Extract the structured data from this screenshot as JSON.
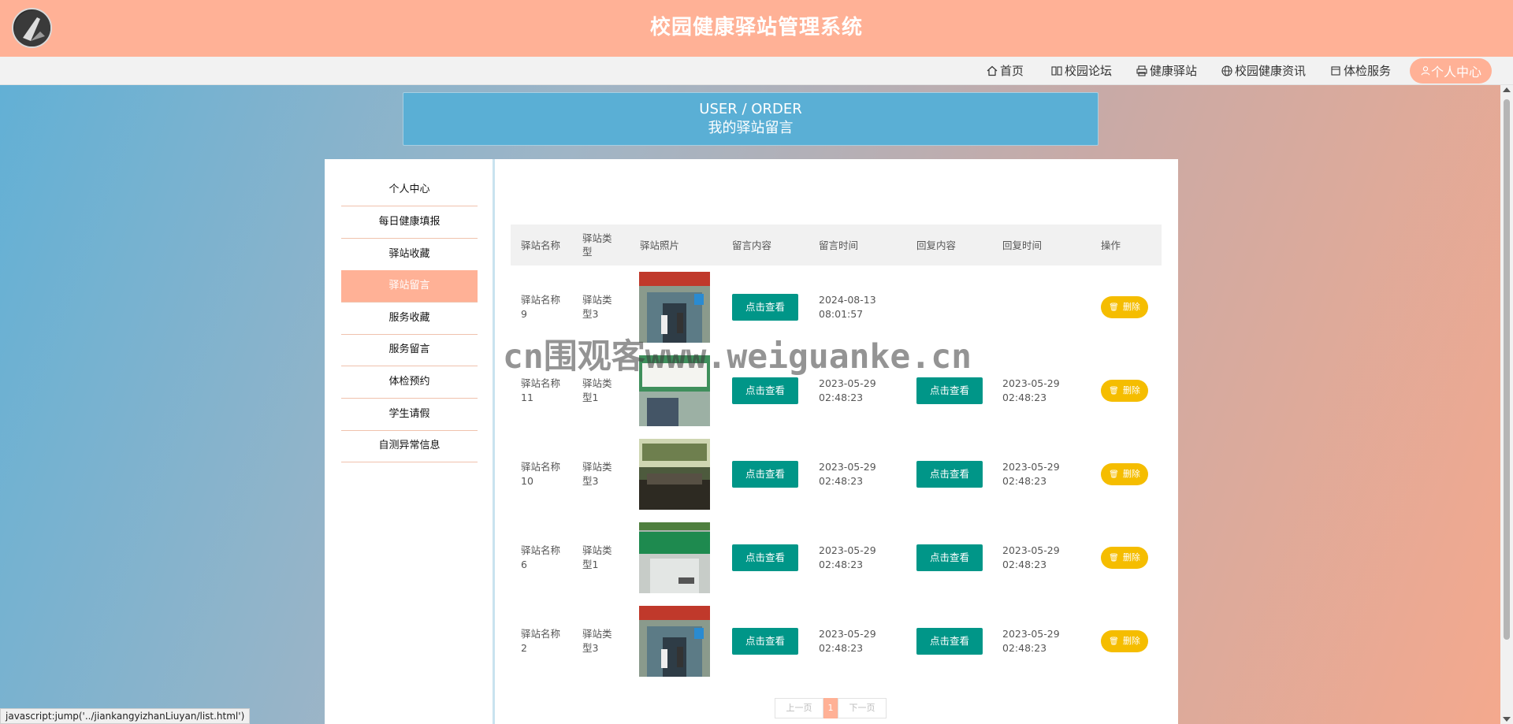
{
  "site": {
    "title": "校园健康驿站管理系统"
  },
  "nav": {
    "items": [
      {
        "label": "首页",
        "icon": "home-icon"
      },
      {
        "label": "校园论坛",
        "icon": "book-icon"
      },
      {
        "label": "健康驿站",
        "icon": "printer-icon"
      },
      {
        "label": "校园健康资讯",
        "icon": "globe-icon"
      },
      {
        "label": "体检服务",
        "icon": "calendar-icon"
      }
    ],
    "active": {
      "label": "个人中心",
      "icon": "user-icon"
    }
  },
  "header": {
    "en": "USER / ORDER",
    "cn": "我的驿站留言"
  },
  "sidebar": {
    "items": [
      {
        "label": "个人中心"
      },
      {
        "label": "每日健康填报"
      },
      {
        "label": "驿站收藏"
      },
      {
        "label": "驿站留言",
        "active": true
      },
      {
        "label": "服务收藏"
      },
      {
        "label": "服务留言"
      },
      {
        "label": "体检预约"
      },
      {
        "label": "学生请假"
      },
      {
        "label": "自测异常信息"
      }
    ]
  },
  "table": {
    "columns": [
      "驿站名称",
      "驿站类型",
      "驿站照片",
      "留言内容",
      "留言时间",
      "回复内容",
      "回复时间",
      "操作"
    ],
    "view_label": "点击查看",
    "delete_label": "删除",
    "rows": [
      {
        "name": "驿站名称9",
        "type": "驿站类型3",
        "photo": "station-photo-a",
        "msg_time": "2024-08-13 08:01:57",
        "reply_time": "",
        "has_reply": false
      },
      {
        "name": "驿站名称11",
        "type": "驿站类型1",
        "photo": "station-photo-b",
        "msg_time": "2023-05-29 02:48:23",
        "reply_time": "2023-05-29 02:48:23",
        "has_reply": true
      },
      {
        "name": "驿站名称10",
        "type": "驿站类型3",
        "photo": "station-photo-c",
        "msg_time": "2023-05-29 02:48:23",
        "reply_time": "2023-05-29 02:48:23",
        "has_reply": true
      },
      {
        "name": "驿站名称6",
        "type": "驿站类型1",
        "photo": "station-photo-d",
        "msg_time": "2023-05-29 02:48:23",
        "reply_time": "2023-05-29 02:48:23",
        "has_reply": true
      },
      {
        "name": "驿站名称2",
        "type": "驿站类型3",
        "photo": "station-photo-a",
        "msg_time": "2023-05-29 02:48:23",
        "reply_time": "2023-05-29 02:48:23",
        "has_reply": true
      }
    ]
  },
  "pager": {
    "prev": "上一页",
    "current": "1",
    "next": "下一页"
  },
  "watermark": "cn围观客www.weiguanke.cn",
  "status_url": "javascript:jump('../jiankangyizhanLiuyan/list.html')",
  "colors": {
    "topbar": "#ffb196",
    "header": "#5aafd5",
    "view_button": "#009688",
    "delete_button": "#f5bd00"
  }
}
